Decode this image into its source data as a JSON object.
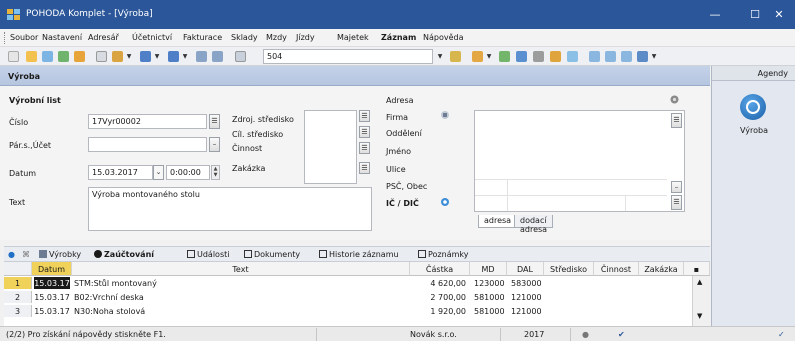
{
  "window": {
    "title": "POHODA Komplet - [Výroba]",
    "minimize": "—",
    "maximize": "☐",
    "close": "✕"
  },
  "menu": {
    "items": [
      "Soubor",
      "Nastavení",
      "Adresář",
      "Účetnictví",
      "Fakturace",
      "Sklady",
      "Mzdy",
      "Jízdy",
      "Majetek",
      "Záznam",
      "Nápověda"
    ]
  },
  "toolbar": {
    "record_field": "504"
  },
  "section": {
    "title": "Výroba"
  },
  "agenda": {
    "header": "Agendy",
    "item_label": "Výroba"
  },
  "form": {
    "list_title": "Výrobní list",
    "cislo_label": "Číslo",
    "cislo_value": "17Vyr00002",
    "pars_label": "Pár.s.,Účet",
    "pars_value": "",
    "datum_label": "Datum",
    "datum_value": "15.03.2017",
    "time_value": "0:00:00",
    "text_label": "Text",
    "text_value": "Výroba montovaného stolu",
    "zdroj_label": "Zdroj. středisko",
    "cil_label": "Cíl. středisko",
    "cinnost_label": "Činnost",
    "zakazka_label": "Zakázka"
  },
  "address": {
    "title": "Adresa",
    "firma": "Firma",
    "oddeleni": "Oddělení",
    "jmeno": "Jméno",
    "ulice": "Ulice",
    "psc": "PSČ, Obec",
    "ic_dic": "IČ / DIČ",
    "tab_adresa": "adresa",
    "tab_dodaci": "dodací adresa"
  },
  "tabs": [
    "Výrobky",
    "Zaúčtování",
    "Události",
    "Dokumenty",
    "Historie záznamu",
    "Poznámky"
  ],
  "table": {
    "headers": [
      "Datum",
      "Text",
      "Částka",
      "MD",
      "DAL",
      "Středisko",
      "Činnost",
      "Zakázka"
    ],
    "rows": [
      {
        "n": "1",
        "datum": "15.03.17",
        "text": "STM:Stůl montovaný",
        "castka": "4 620,00",
        "md": "123000",
        "dal": "583000"
      },
      {
        "n": "2",
        "datum": "15.03.17",
        "text": "B02:Vrchní deska",
        "castka": "2 700,00",
        "md": "581000",
        "dal": "121000"
      },
      {
        "n": "3",
        "datum": "15.03.17",
        "text": "N30:Noha stolová",
        "castka": "1 920,00",
        "md": "581000",
        "dal": "121000"
      }
    ]
  },
  "status": {
    "help": "(2/2) Pro získání nápovědy stiskněte F1.",
    "company": "Novák s.r.o.",
    "year": "2017"
  },
  "colors": {
    "titlebar": "#2b579a",
    "section": "#c4d2e8",
    "selected": "#f0d25a"
  }
}
